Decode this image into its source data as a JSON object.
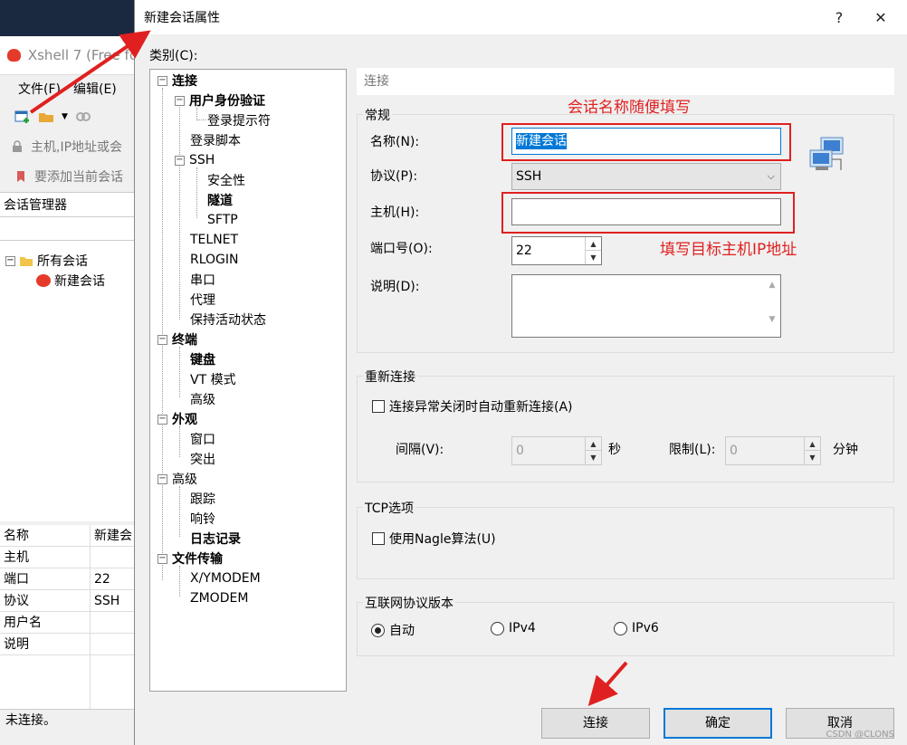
{
  "bg_window": {
    "title": "Xshell 7 (Free fo",
    "menu": [
      "文件(F)",
      "编辑(E)"
    ],
    "address_placeholder": "主机,IP地址或会",
    "notice": "要添加当前会话",
    "panel_title": "会话管理器",
    "tree": {
      "root": "所有会话",
      "child": "新建会话"
    },
    "props": [
      {
        "k": "名称",
        "v": "新建会"
      },
      {
        "k": "主机",
        "v": ""
      },
      {
        "k": "端口",
        "v": "22"
      },
      {
        "k": "协议",
        "v": "SSH"
      },
      {
        "k": "用户名",
        "v": ""
      },
      {
        "k": "说明",
        "v": ""
      }
    ],
    "status": "未连接。"
  },
  "dialog": {
    "title": "新建会话属性",
    "help": "?",
    "close": "✕",
    "category_label": "类别(C):",
    "tree": {
      "conn": "连接",
      "auth": "用户身份验证",
      "login_prompt": "登录提示符",
      "login_script": "登录脚本",
      "ssh": "SSH",
      "security": "安全性",
      "tunnel": "隧道",
      "sftp": "SFTP",
      "telnet": "TELNET",
      "rlogin": "RLOGIN",
      "serial": "串口",
      "proxy": "代理",
      "keepalive": "保持活动状态",
      "terminal": "终端",
      "keyboard": "键盘",
      "vt": "VT 模式",
      "advanced_t": "高级",
      "appearance": "外观",
      "window": "窗口",
      "highlight": "突出",
      "advanced": "高级",
      "trace": "跟踪",
      "bell": "响铃",
      "logging": "日志记录",
      "transfer": "文件传输",
      "xymodem": "X/YMODEM",
      "zmodem": "ZMODEM"
    },
    "panel_head": "连接",
    "general": {
      "title": "常规",
      "name_label": "名称(N):",
      "name_value": "新建会话",
      "protocol_label": "协议(P):",
      "protocol_value": "SSH",
      "host_label": "主机(H):",
      "host_value": "",
      "port_label": "端口号(O):",
      "port_value": "22",
      "desc_label": "说明(D):"
    },
    "reconnect": {
      "title": "重新连接",
      "auto_label": "连接异常关闭时自动重新连接(A)",
      "interval_label": "间隔(V):",
      "interval_value": "0",
      "sec": "秒",
      "limit_label": "限制(L):",
      "limit_value": "0",
      "min": "分钟"
    },
    "tcp": {
      "title": "TCP选项",
      "nagle_label": "使用Nagle算法(U)"
    },
    "ipver": {
      "title": "互联网协议版本",
      "auto": "自动",
      "v4": "IPv4",
      "v6": "IPv6"
    },
    "buttons": {
      "connect": "连接",
      "ok": "确定",
      "cancel": "取消"
    }
  },
  "annotations": {
    "name_hint": "会话名称随便填写",
    "host_hint": "填写目标主机IP地址",
    "color": "#e02020"
  },
  "watermark": "CSDN @CLONS"
}
